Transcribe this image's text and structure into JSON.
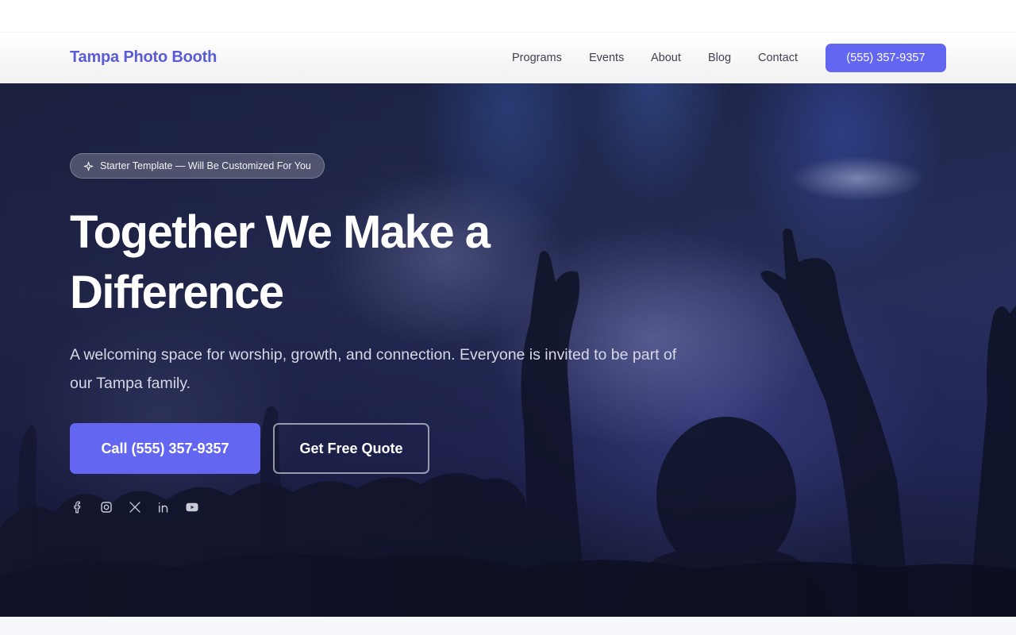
{
  "nav": {
    "brand": "Tampa Photo Booth",
    "links": [
      "Programs",
      "Events",
      "About",
      "Blog",
      "Contact"
    ],
    "cta_label": "(555) 357-9357"
  },
  "hero": {
    "badge": "Starter Template — Will Be Customized For You",
    "badge_icon": "sparkle-icon",
    "headline": "Together We Make a Difference",
    "subtext": "A welcoming space for worship, growth, and connection. Everyone is invited to be part of our Tampa family.",
    "primary_button": "Call (555) 357-9357",
    "secondary_button": "Get Free Quote",
    "socials": [
      "facebook-icon",
      "instagram-icon",
      "x-icon",
      "linkedin-icon",
      "youtube-icon"
    ]
  },
  "colors": {
    "accent": "#6366f1",
    "brand_text": "#5b5bd6",
    "hero_dark": "#1b2040"
  }
}
